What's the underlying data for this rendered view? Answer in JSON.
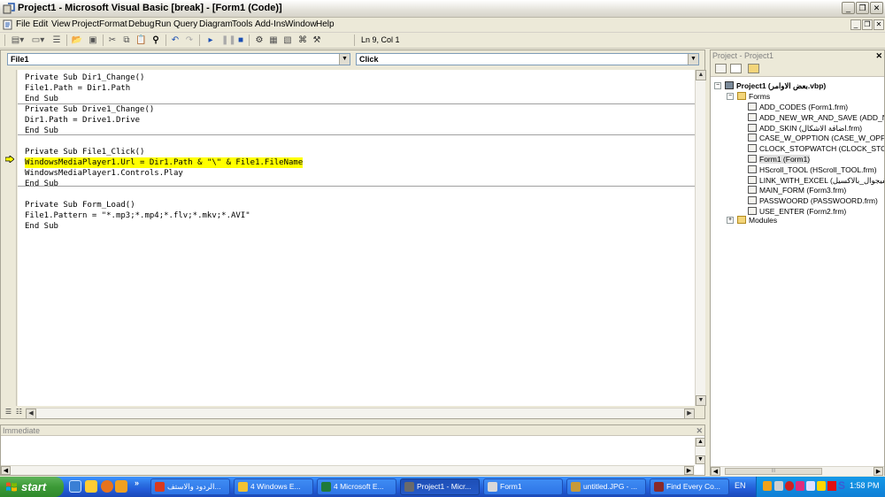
{
  "window": {
    "title": "Project1 - Microsoft Visual Basic [break] - [Form1 (Code)]",
    "caption_buttons": [
      "_",
      "❐",
      "✕"
    ],
    "mdi_buttons": [
      "_",
      "❐",
      "✕"
    ]
  },
  "menubar": {
    "items": [
      "File",
      "Edit",
      "View",
      "Project",
      "Format",
      "Debug",
      "Run",
      "Query",
      "Diagram",
      "Tools",
      "Add-Ins",
      "Window",
      "Help"
    ]
  },
  "toolbar": {
    "status": "Ln 9, Col 1",
    "icons": [
      "add-project-icon",
      "add-form-icon",
      "menu-editor-icon",
      "open-icon",
      "save-icon",
      "cut-icon",
      "copy-icon",
      "paste-icon",
      "find-icon",
      "undo-icon",
      "redo-icon",
      "run-icon",
      "break-icon",
      "stop-icon",
      "project-explorer-icon",
      "properties-icon",
      "form-layout-icon",
      "object-browser-icon",
      "toolbox-icon"
    ]
  },
  "code_window": {
    "object_combo": "File1",
    "procedure_combo": "Click",
    "lines": [
      {
        "text": "Private Sub Dir1_Change()"
      },
      {
        "text": "File1.Path = Dir1.Path"
      },
      {
        "text": "End Sub"
      },
      {
        "text": "Private Sub Drive1_Change()"
      },
      {
        "text": "Dir1.Path = Drive1.Drive"
      },
      {
        "text": "End Sub"
      },
      {
        "text": ""
      },
      {
        "text": "Private Sub File1_Click()"
      },
      {
        "text": "WindowsMediaPlayer1.Url = Dir1.Path & \"\\\" & File1.FileName",
        "highlight": true
      },
      {
        "text": "WindowsMediaPlayer1.Controls.Play"
      },
      {
        "text": "End Sub"
      },
      {
        "text": ""
      },
      {
        "text": "Private Sub Form_Load()"
      },
      {
        "text": "File1.Pattern = \"*.mp3;*.mp4;*.flv;*.mkv;*.AVI\""
      },
      {
        "text": "End Sub"
      }
    ]
  },
  "immediate": {
    "title": "Immediate",
    "close": "✕"
  },
  "project_explorer": {
    "title": "Project - Project1",
    "close": "✕",
    "root": "Project1 (بعض الاوامر.vbp)",
    "forms_folder": "Forms",
    "forms": [
      "ADD_CODES (Form1.frm)",
      "ADD_NEW_WR_AND_SAVE (ADD_NEW",
      "ADD_SKIN (اضافة الاشكال.frm)",
      "CASE_W_OPPTION (CASE_W_OPPTION",
      "CLOCK_STOPWATCH (CLOCK_STOPWA",
      "Form1 (Form1)",
      "HScroll_TOOL (HScroll_TOOL.frm)",
      "LINK_WITH_EXCEL (الفيجوال_بالاكسيل",
      "MAIN_FORM (Form3.frm)",
      "PASSWOORD (PASSWOORD.frm)",
      "USE_ENTER (Form2.frm)"
    ],
    "modules_folder": "Modules",
    "scroll_thumb": "III"
  },
  "taskbar": {
    "start": "start",
    "tasks": [
      {
        "label": "الردود والاستف...",
        "icon_color": "#d93a1f"
      },
      {
        "label": "4 Windows E...",
        "icon_color": "#f1c232"
      },
      {
        "label": "4 Microsoft E...",
        "icon_color": "#1f7a3a"
      },
      {
        "label": "Project1 - Micr...",
        "icon_color": "#6a6a6a",
        "active": true
      },
      {
        "label": "Form1",
        "icon_color": "#d8d8d8"
      },
      {
        "label": "untitled.JPG - ...",
        "icon_color": "#c79a3a"
      },
      {
        "label": "Find Every Co...",
        "icon_color": "#8a2a2a"
      }
    ],
    "language": "EN",
    "clock": "1:58 PM"
  }
}
